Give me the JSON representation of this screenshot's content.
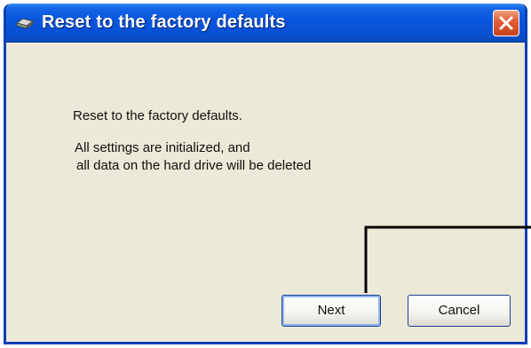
{
  "window": {
    "title": "Reset to the factory defaults",
    "title_icon": "hard-drive-icon",
    "close_icon": "close-icon"
  },
  "message": {
    "line1": "Reset to the factory defaults.",
    "line2": "All settings are initialized, and",
    "line3": "all data on the hard drive will be deleted"
  },
  "buttons": {
    "next_label": "Next",
    "cancel_label": "Cancel"
  },
  "colors": {
    "titlebar": "#0856dd",
    "window_bg": "#ece9d8",
    "close_button": "#e2603c",
    "callout_line": "#000000"
  }
}
